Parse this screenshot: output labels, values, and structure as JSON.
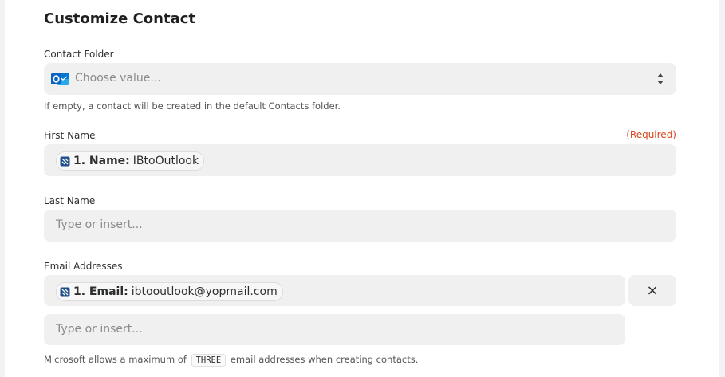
{
  "section": {
    "title": "Customize Contact"
  },
  "contact_folder": {
    "label": "Contact Folder",
    "placeholder": "Choose value...",
    "help": "If empty, a contact will be created in the default Contacts folder."
  },
  "first_name": {
    "label": "First Name",
    "required": "(Required)",
    "pill": {
      "step": "1. Name:",
      "value": "IBtoOutlook"
    }
  },
  "last_name": {
    "label": "Last Name",
    "placeholder": "Type or insert..."
  },
  "email_addresses": {
    "label": "Email Addresses",
    "pill": {
      "step": "1. Email:",
      "value": "ibtooutlook@yopmail.com"
    },
    "remove_label": "×",
    "new_placeholder": "Type or insert...",
    "help_before": "Microsoft allows a maximum of",
    "help_highlight": "THREE",
    "help_after": "email addresses when creating contacts."
  },
  "colors": {
    "required": "#d9471d",
    "field_bg": "#f0f0f0",
    "outlook_blue": "#0a64c1"
  }
}
